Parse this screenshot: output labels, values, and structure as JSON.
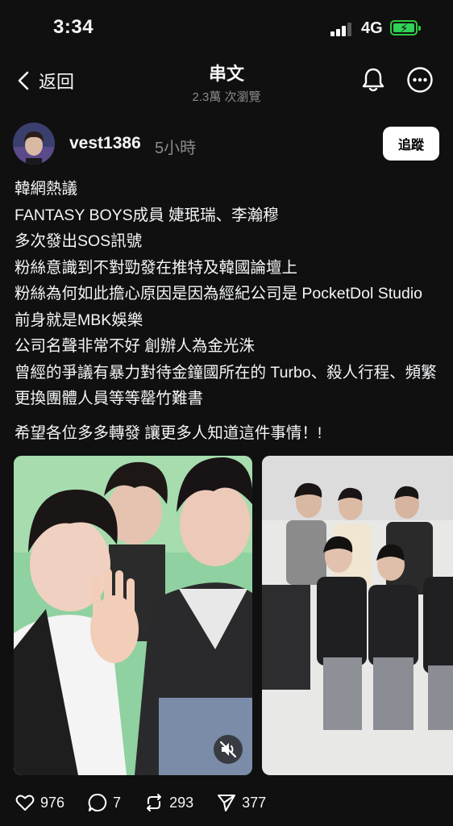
{
  "status_bar": {
    "time": "3:34",
    "network": "4G"
  },
  "header": {
    "back_label": "返回",
    "title": "串文",
    "subtitle": "2.3萬 次瀏覽"
  },
  "post": {
    "username": "vest1386",
    "time": "5小時",
    "follow_label": "追蹤",
    "lines": [
      "韓網熱議",
      "FANTASY BOYS成員 婕珉瑞、李瀚穆",
      "多次發出SOS訊號",
      "粉絲意識到不對勁發在推特及韓國論壇上",
      "粉絲為何如此擔心原因是因為經紀公司是 PocketDol Studio 前身就是MBK娛樂",
      "公司名聲非常不好 創辦人為金光洙",
      "曾經的爭議有暴力對待金鐘國所在的 Turbo、殺人行程、頻繁更換團體人員等等罄竹難書",
      "希望各位多多轉發 讓更多人知道這件事情！!"
    ],
    "media": [
      {
        "type": "video",
        "alt": "photo-1"
      },
      {
        "type": "image",
        "alt": "photo-2"
      }
    ]
  },
  "actions": {
    "likes": "976",
    "replies": "7",
    "reposts": "293",
    "shares": "377"
  },
  "icons": {
    "back": "chevron-left-icon",
    "bell": "bell-icon",
    "more": "more-icon",
    "like": "heart-icon",
    "reply": "comment-icon",
    "repost": "repost-icon",
    "share": "send-icon",
    "mute": "muted-speaker-icon"
  },
  "colors": {
    "background": "#101010",
    "text": "#f3f5f7",
    "muted": "#8a8a8a",
    "battery": "#30d158"
  }
}
